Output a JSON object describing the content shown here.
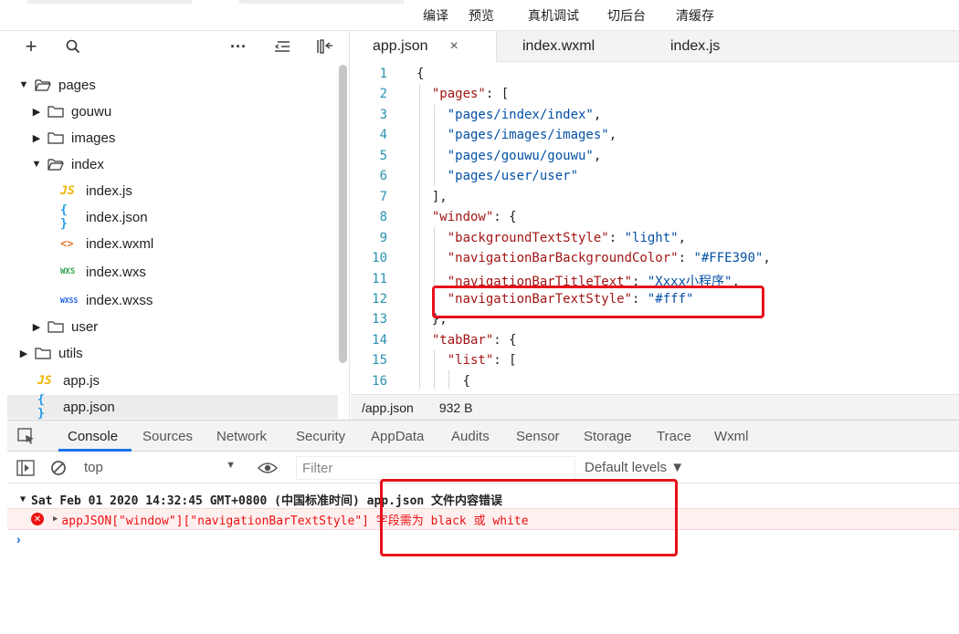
{
  "toolbar": {
    "buttons": [
      "编译",
      "预览",
      "真机调试",
      "切后台",
      "清缓存"
    ]
  },
  "explorer": {
    "tree": [
      {
        "label": "pages",
        "kind": "folder",
        "expanded": true
      },
      {
        "label": "gouwu",
        "kind": "folder",
        "expanded": false
      },
      {
        "label": "images",
        "kind": "folder",
        "expanded": false
      },
      {
        "label": "index",
        "kind": "folder",
        "expanded": true
      },
      {
        "label": "index.js",
        "kind": "js",
        "badge": "JS"
      },
      {
        "label": "index.json",
        "kind": "json",
        "badge": "{ }"
      },
      {
        "label": "index.wxml",
        "kind": "wxml",
        "badge": "<>"
      },
      {
        "label": "index.wxs",
        "kind": "wxs",
        "badge": "WXS"
      },
      {
        "label": "index.wxss",
        "kind": "wxss",
        "badge": "WXSS"
      },
      {
        "label": "user",
        "kind": "folder",
        "expanded": false
      },
      {
        "label": "utils",
        "kind": "folder",
        "expanded": false
      },
      {
        "label": "app.js",
        "kind": "js",
        "badge": "JS"
      },
      {
        "label": "app.json",
        "kind": "json",
        "badge": "{ }",
        "selected": true
      }
    ]
  },
  "editor": {
    "tabs": [
      "app.json",
      "index.wxml",
      "index.js"
    ],
    "active_tab": "app.json",
    "close_glyph": "×",
    "lines": [
      {
        "n": "1",
        "text": "{"
      },
      {
        "n": "2",
        "text": "  \"pages\": ["
      },
      {
        "n": "3",
        "text": "    \"pages/index/index\","
      },
      {
        "n": "4",
        "text": "    \"pages/images/images\","
      },
      {
        "n": "5",
        "text": "    \"pages/gouwu/gouwu\","
      },
      {
        "n": "6",
        "text": "    \"pages/user/user\""
      },
      {
        "n": "7",
        "text": "  ],"
      },
      {
        "n": "8",
        "text": "  \"window\": {"
      },
      {
        "n": "9",
        "text": "    \"backgroundTextStyle\": \"light\","
      },
      {
        "n": "10",
        "text": "    \"navigationBarBackgroundColor\": \"#FFE390\","
      },
      {
        "n": "11",
        "text": "    \"navigationBarTitleText\": \"Xxxx小程序\","
      },
      {
        "n": "12",
        "text": "    \"navigationBarTextStyle\": \"#fff\""
      },
      {
        "n": "13",
        "text": "  },"
      },
      {
        "n": "14",
        "text": "  \"tabBar\": {"
      },
      {
        "n": "15",
        "text": "    \"list\": ["
      },
      {
        "n": "16",
        "text": "      {"
      }
    ],
    "status": {
      "path": "/app.json",
      "size": "932 B"
    }
  },
  "devtools": {
    "tabs": [
      "Console",
      "Sources",
      "Network",
      "Security",
      "AppData",
      "Audits",
      "Sensor",
      "Storage",
      "Trace",
      "Wxml"
    ],
    "active_tab": "Console",
    "context": "top",
    "filter_placeholder": "Filter",
    "levels": "Default levels ▼",
    "group_header": "Sat Feb 01 2020 14:32:45 GMT+0800 (中国标准时间)  app.json 文件内容错误",
    "error_message": "appJSON[\"window\"][\"navigationBarTextStyle\"] 字段需为 black 或 white",
    "prompt": "›"
  },
  "colors": {
    "accent": "#1a73e8",
    "error": "#e11111",
    "highlight_box": "#e8101b",
    "line_numbers": "#2b91af",
    "json_key": "#a31515",
    "json_string": "#0451a5"
  }
}
